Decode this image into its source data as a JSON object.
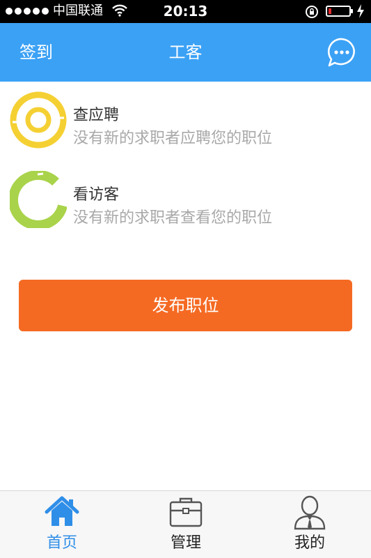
{
  "status_bar": {
    "carrier": "中国联通",
    "time": "20:13",
    "battery_level": 0.15
  },
  "nav": {
    "left_label": "签到",
    "title": "工客",
    "right_icon": "chat-bubble-icon"
  },
  "list": [
    {
      "title": "查应聘",
      "subtitle": "没有新的求职者应聘您的职位",
      "icon": "yellow-ring-icon"
    },
    {
      "title": "看访客",
      "subtitle": "没有新的求职者查看您的职位",
      "icon": "green-arc-icon"
    }
  ],
  "publish_button": {
    "label": "发布职位"
  },
  "tabs": [
    {
      "label": "首页",
      "icon": "home-icon",
      "active": true
    },
    {
      "label": "管理",
      "icon": "briefcase-icon",
      "active": false
    },
    {
      "label": "我的",
      "icon": "person-icon",
      "active": false
    }
  ],
  "colors": {
    "accent_blue": "#3ba1f5",
    "publish_orange": "#f56a23",
    "active_tab": "#2f8ee8"
  }
}
